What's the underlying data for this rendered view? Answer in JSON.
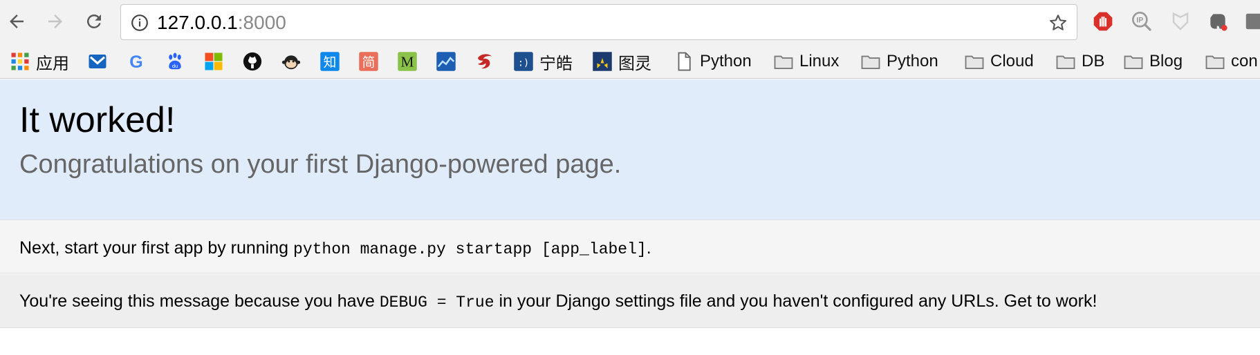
{
  "browser": {
    "url_host": "127.0.0.1",
    "url_port": ":8000",
    "accent": "#1a73e8"
  },
  "bookmarks": [
    {
      "label": "应用",
      "icon": "apps-grid-icon"
    },
    {
      "label": "",
      "icon": "mail-icon"
    },
    {
      "label": "",
      "icon": "google-icon"
    },
    {
      "label": "",
      "icon": "baidu-icon"
    },
    {
      "label": "",
      "icon": "microsoft-icon"
    },
    {
      "label": "",
      "icon": "github-icon"
    },
    {
      "label": "",
      "icon": "monkey-icon"
    },
    {
      "label": "",
      "icon": "zhihu-icon"
    },
    {
      "label": "",
      "icon": "jianshu-icon"
    },
    {
      "label": "",
      "icon": "m-icon"
    },
    {
      "label": "",
      "icon": "chart-icon"
    },
    {
      "label": "",
      "icon": "red-logo-icon"
    },
    {
      "label": "宁皓",
      "icon": "ninghao-icon"
    },
    {
      "label": "图灵",
      "icon": "turing-icon"
    },
    {
      "label": "Python",
      "icon": "page-icon"
    },
    {
      "label": "Linux",
      "icon": "folder-icon"
    },
    {
      "label": "Python",
      "icon": "folder-icon"
    },
    {
      "label": "Cloud",
      "icon": "folder-icon"
    },
    {
      "label": "DB",
      "icon": "folder-icon"
    },
    {
      "label": "Blog",
      "icon": "folder-icon"
    },
    {
      "label": "con",
      "icon": "folder-icon"
    }
  ],
  "page": {
    "title": "It worked!",
    "subtitle": "Congratulations on your first Django-powered page.",
    "instructions": {
      "before": "Next, start your first app by running ",
      "code": "python manage.py startapp [app_label]",
      "after": "."
    },
    "explanation": {
      "before": "You're seeing this message because you have ",
      "code": "DEBUG = True",
      "after": " in your Django settings file and you haven't configured any URLs. Get to work!"
    }
  }
}
